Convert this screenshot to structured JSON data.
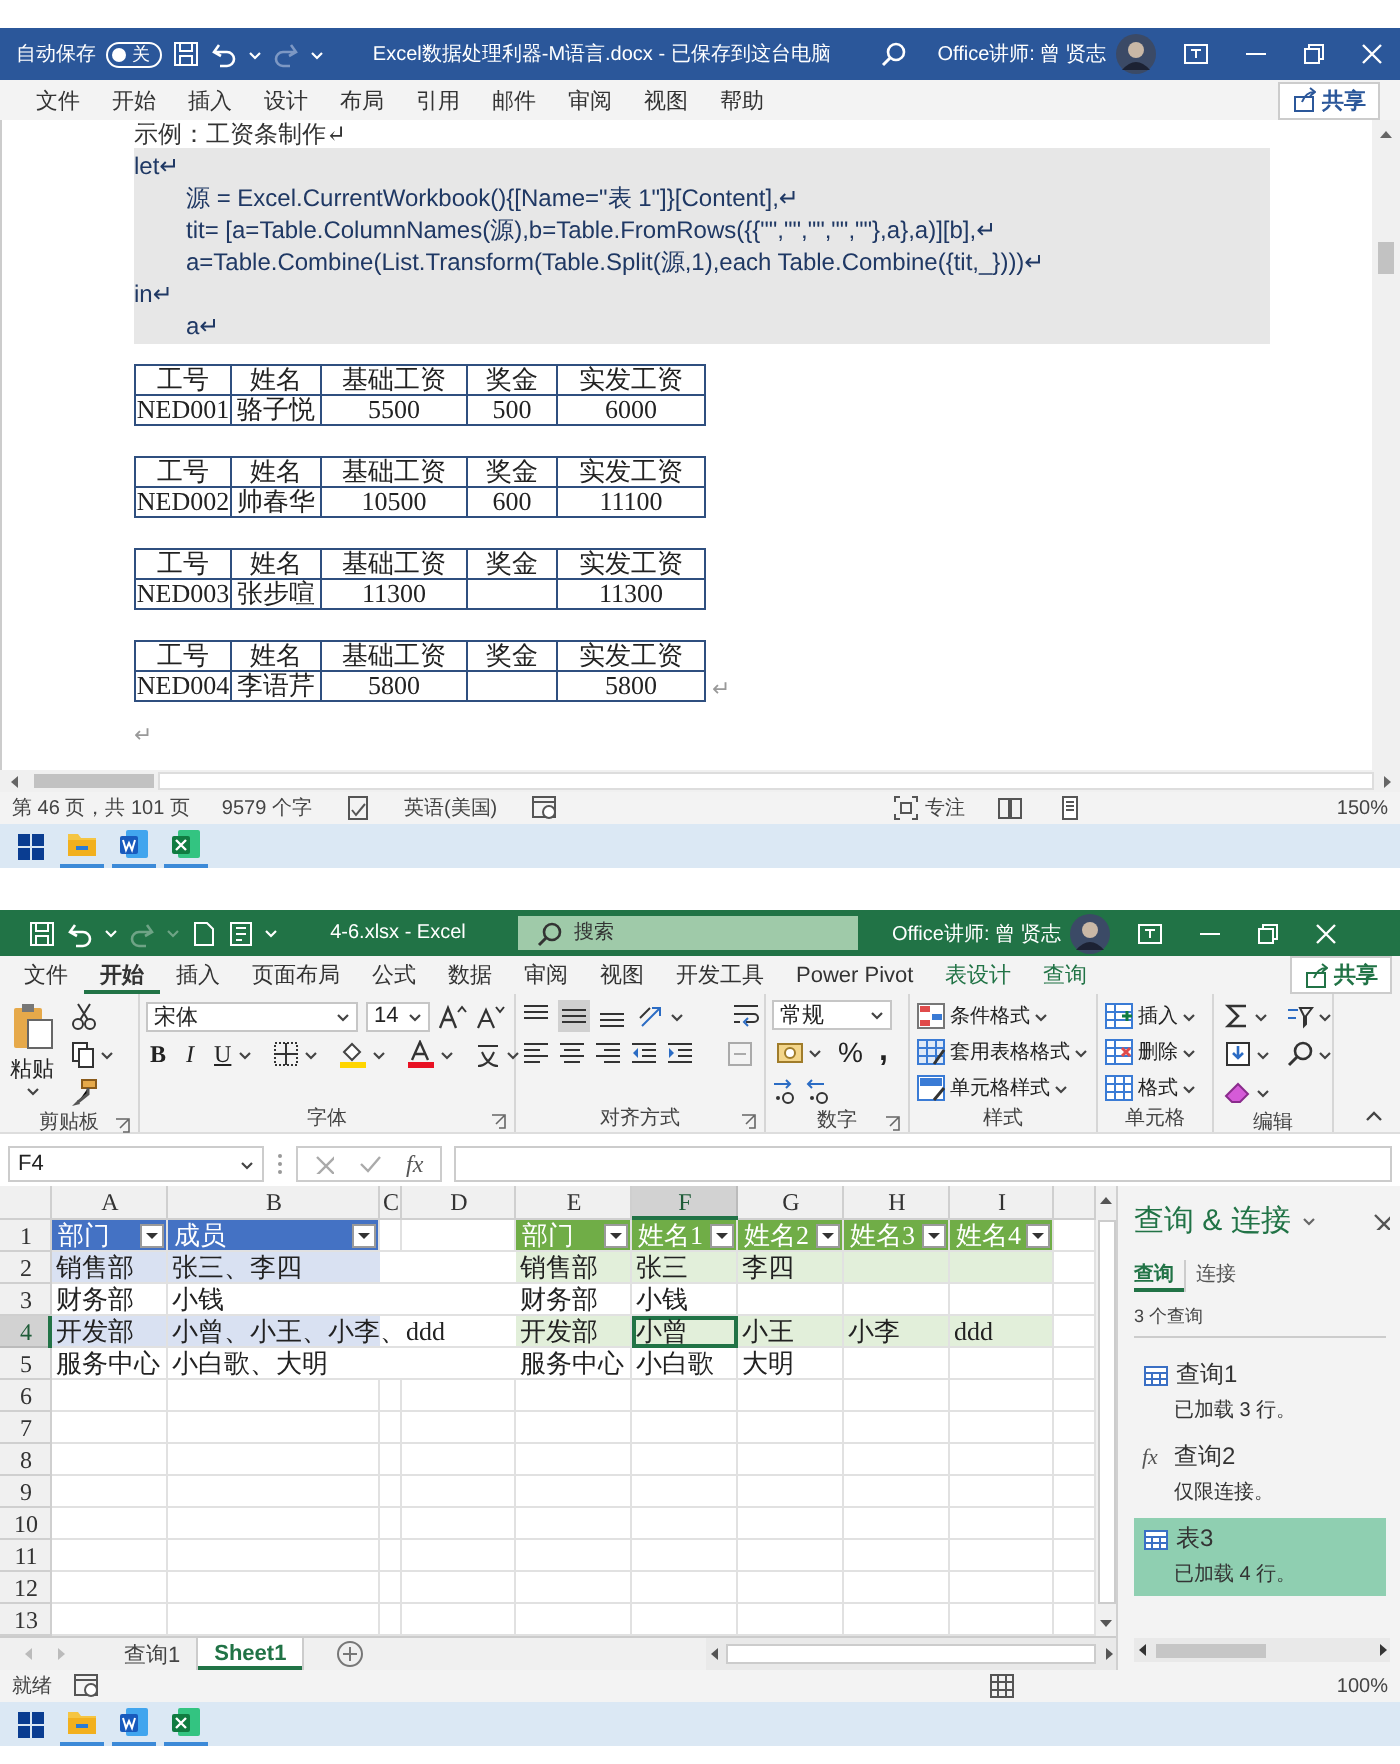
{
  "word": {
    "title_bar": {
      "autosave_label": "自动保存",
      "autosave": {
        "on": false,
        "label": "关"
      },
      "title": "Excel数据处理利器-M语言.docx  -  已保存到这台电脑",
      "user": "Office讲师: 曾 贤志"
    },
    "menu": [
      {
        "label": "文件",
        "selected": false
      },
      {
        "label": "开始",
        "selected": false
      },
      {
        "label": "插入",
        "selected": false
      },
      {
        "label": "设计",
        "selected": false
      },
      {
        "label": "布局",
        "selected": false
      },
      {
        "label": "引用",
        "selected": false
      },
      {
        "label": "邮件",
        "selected": false
      },
      {
        "label": "审阅",
        "selected": false
      },
      {
        "label": "视图",
        "selected": false
      },
      {
        "label": "帮助",
        "selected": false
      }
    ],
    "share": "共享",
    "document": {
      "heading": "示例：工资条制作↵",
      "code": [
        {
          "text": "let↵",
          "indented": false
        },
        {
          "text": "源  = Excel.CurrentWorkbook(){[Name=\"表 1\"]}[Content],↵",
          "indented": true
        },
        {
          "text": "tit= [a=Table.ColumnNames(源),b=Table.FromRows({{\"\",\"\",\"\",\"\",\"\"},a},a)][b],↵",
          "indented": true
        },
        {
          "text": "a=Table.Combine(List.Transform(Table.Split(源,1),each Table.Combine({tit,_})))↵",
          "indented": true
        },
        {
          "text": "in↵",
          "indented": false
        },
        {
          "text": "a↵",
          "indented": true
        }
      ],
      "slips": [
        {
          "header": {
            "id": "工号",
            "name": "姓名",
            "base": "基础工资",
            "bonus": "奖金",
            "total": "实发工资"
          },
          "row": {
            "id": "NED001",
            "name": "骆子悦",
            "base": "5500",
            "bonus": "500",
            "total": "6000"
          }
        },
        {
          "header": {
            "id": "工号",
            "name": "姓名",
            "base": "基础工资",
            "bonus": "奖金",
            "total": "实发工资"
          },
          "row": {
            "id": "NED002",
            "name": "帅春华",
            "base": "10500",
            "bonus": "600",
            "total": "11100"
          }
        },
        {
          "header": {
            "id": "工号",
            "name": "姓名",
            "base": "基础工资",
            "bonus": "奖金",
            "total": "实发工资"
          },
          "row": {
            "id": "NED003",
            "name": "张步喧",
            "base": "11300",
            "total": "11300"
          }
        },
        {
          "header": {
            "id": "工号",
            "name": "姓名",
            "base": "基础工资",
            "bonus": "奖金",
            "total": "实发工资"
          },
          "row": {
            "id": "NED004",
            "name": "李语芹",
            "base": "5800",
            "total": "5800"
          },
          "end_mark": "↵"
        }
      ],
      "trailing_mark": "↵"
    },
    "status_bar": {
      "page": "第 46 页，共 101 页",
      "words": "9579 个字",
      "language": "英语(美国)",
      "focus": "专注",
      "zoom": "150%"
    }
  },
  "excel": {
    "title_bar": {
      "title": "4-6.xlsx  -  Excel",
      "search_placeholder": "搜索",
      "user": "Office讲师: 曾 贤志"
    },
    "menu": [
      {
        "label": "文件",
        "selected": false,
        "kind": "standard"
      },
      {
        "label": "开始",
        "selected": true,
        "kind": "standard"
      },
      {
        "label": "插入",
        "selected": false,
        "kind": "standard"
      },
      {
        "label": "页面布局",
        "selected": false,
        "kind": "standard"
      },
      {
        "label": "公式",
        "selected": false,
        "kind": "standard"
      },
      {
        "label": "数据",
        "selected": false,
        "kind": "standard"
      },
      {
        "label": "审阅",
        "selected": false,
        "kind": "standard"
      },
      {
        "label": "视图",
        "selected": false,
        "kind": "standard"
      },
      {
        "label": "开发工具",
        "selected": false,
        "kind": "standard"
      },
      {
        "label": "Power Pivot",
        "selected": false,
        "kind": "standard"
      },
      {
        "label": "表设计",
        "selected": false,
        "kind": "contextual"
      },
      {
        "label": "查询",
        "selected": false,
        "kind": "contextual"
      }
    ],
    "share": "共享",
    "ribbon": {
      "clipboard": {
        "paste": "粘贴",
        "group": "剪贴板"
      },
      "font": {
        "name": "宋体",
        "size": "14",
        "bold": "B",
        "italic": "I",
        "underline": "U",
        "group": "字体"
      },
      "alignment": {
        "group": "对齐方式"
      },
      "number": {
        "format": "常规",
        "percent": "%",
        "comma": ",",
        "group": "数字"
      },
      "styles": {
        "items": [
          "条件格式",
          "套用表格格式",
          "单元格样式"
        ],
        "group": "样式"
      },
      "cells": {
        "items": [
          "插入",
          "删除",
          "格式"
        ],
        "group": "单元格"
      },
      "editing": {
        "group": "编辑"
      }
    },
    "formula_bar": {
      "name_box": "F4",
      "function_label": "fx"
    },
    "grid": {
      "columns": [
        {
          "label": "A",
          "selected": false
        },
        {
          "label": "B",
          "selected": false
        },
        {
          "label": "C",
          "selected": false
        },
        {
          "label": "D",
          "selected": false
        },
        {
          "label": "E",
          "selected": false
        },
        {
          "label": "F",
          "selected": true
        },
        {
          "label": "G",
          "selected": false
        },
        {
          "label": "H",
          "selected": false
        },
        {
          "label": "I",
          "selected": false
        }
      ],
      "rows": [
        {
          "label": "1",
          "selected": false
        },
        {
          "label": "2",
          "selected": false
        },
        {
          "label": "3",
          "selected": false
        },
        {
          "label": "4",
          "selected": true
        },
        {
          "label": "5",
          "selected": false
        },
        {
          "label": "6",
          "selected": false
        },
        {
          "label": "7",
          "selected": false
        },
        {
          "label": "8",
          "selected": false
        },
        {
          "label": "9",
          "selected": false
        },
        {
          "label": "10",
          "selected": false
        },
        {
          "label": "11",
          "selected": false
        },
        {
          "label": "12",
          "selected": false
        },
        {
          "label": "13",
          "selected": false
        }
      ],
      "source_table": {
        "header": [
          "部门",
          "成员"
        ],
        "rows": [
          [
            "销售部",
            "张三、李四"
          ],
          [
            "财务部",
            "小钱"
          ],
          [
            "开发部",
            "小曾、小王、小李、ddd"
          ],
          [
            "服务中心",
            "小白歌、大明"
          ]
        ]
      },
      "result_table": {
        "header": [
          "部门",
          "姓名1",
          "姓名2",
          "姓名3",
          "姓名4"
        ],
        "rows": [
          [
            {
              "text": "销售部",
              "active": false
            },
            {
              "text": "张三",
              "active": false
            },
            {
              "text": "李四",
              "active": false
            }
          ],
          [
            {
              "text": "财务部",
              "active": false
            },
            {
              "text": "小钱",
              "active": false
            }
          ],
          [
            {
              "text": "开发部",
              "active": false
            },
            {
              "text": "小曾",
              "active": true
            },
            {
              "text": "小王",
              "active": false
            },
            {
              "text": "小李",
              "active": false
            },
            {
              "text": "ddd",
              "active": false
            }
          ],
          [
            {
              "text": "服务中心",
              "active": false
            },
            {
              "text": "小白歌",
              "active": false
            },
            {
              "text": "大明",
              "active": false
            }
          ]
        ]
      }
    },
    "sheets": [
      {
        "label": "查询1",
        "selected": false
      },
      {
        "label": "Sheet1",
        "selected": true
      }
    ],
    "queries_pane": {
      "title": "查询 & 连接",
      "tabs": [
        {
          "label": "查询",
          "selected": true
        },
        {
          "label": "连接",
          "selected": false
        }
      ],
      "count": "3 个查询",
      "items": [
        {
          "kind": "table",
          "name": "查询1",
          "status": "已加载 3 行。",
          "selected": false
        },
        {
          "kind": "function",
          "icon_label": "fx",
          "name": "查询2",
          "status": "仅限连接。",
          "selected": false
        },
        {
          "kind": "table",
          "name": "表3",
          "status": "已加载 4 行。",
          "selected": true
        }
      ]
    },
    "status_bar": {
      "state": "就绪",
      "zoom": "100%"
    }
  }
}
